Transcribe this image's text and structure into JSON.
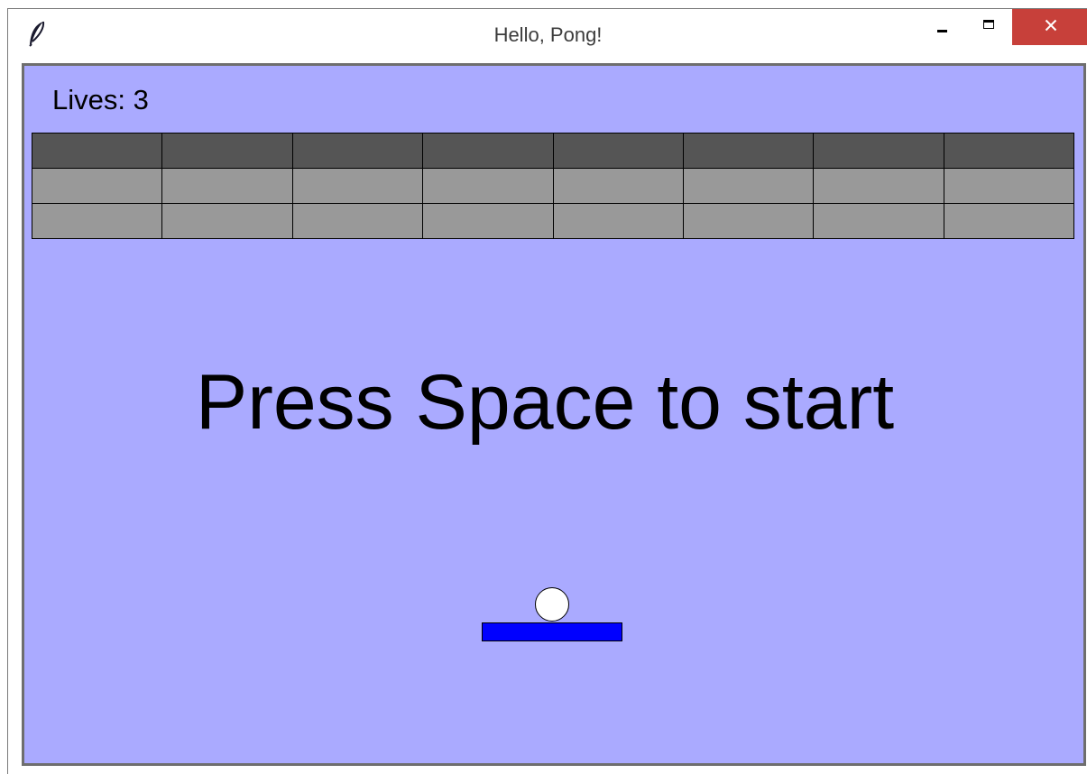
{
  "window": {
    "title": "Hello, Pong!",
    "icon": "feather-icon",
    "controls": {
      "minimize_icon": "minimize-icon",
      "maximize_icon": "maximize-icon",
      "close_icon": "close-icon",
      "close_glyph": "✕",
      "close_color": "#c7403a"
    }
  },
  "game": {
    "lives_label": "Lives: 3",
    "lives": 3,
    "message": "Press Space to start",
    "colors": {
      "background": "#aaaaff",
      "paddle": "#0000ff",
      "ball": "#ffffff",
      "brick_rows": [
        "#555555",
        "#999999",
        "#999999"
      ]
    },
    "bricks": {
      "rows": 3,
      "columns": 8
    }
  }
}
